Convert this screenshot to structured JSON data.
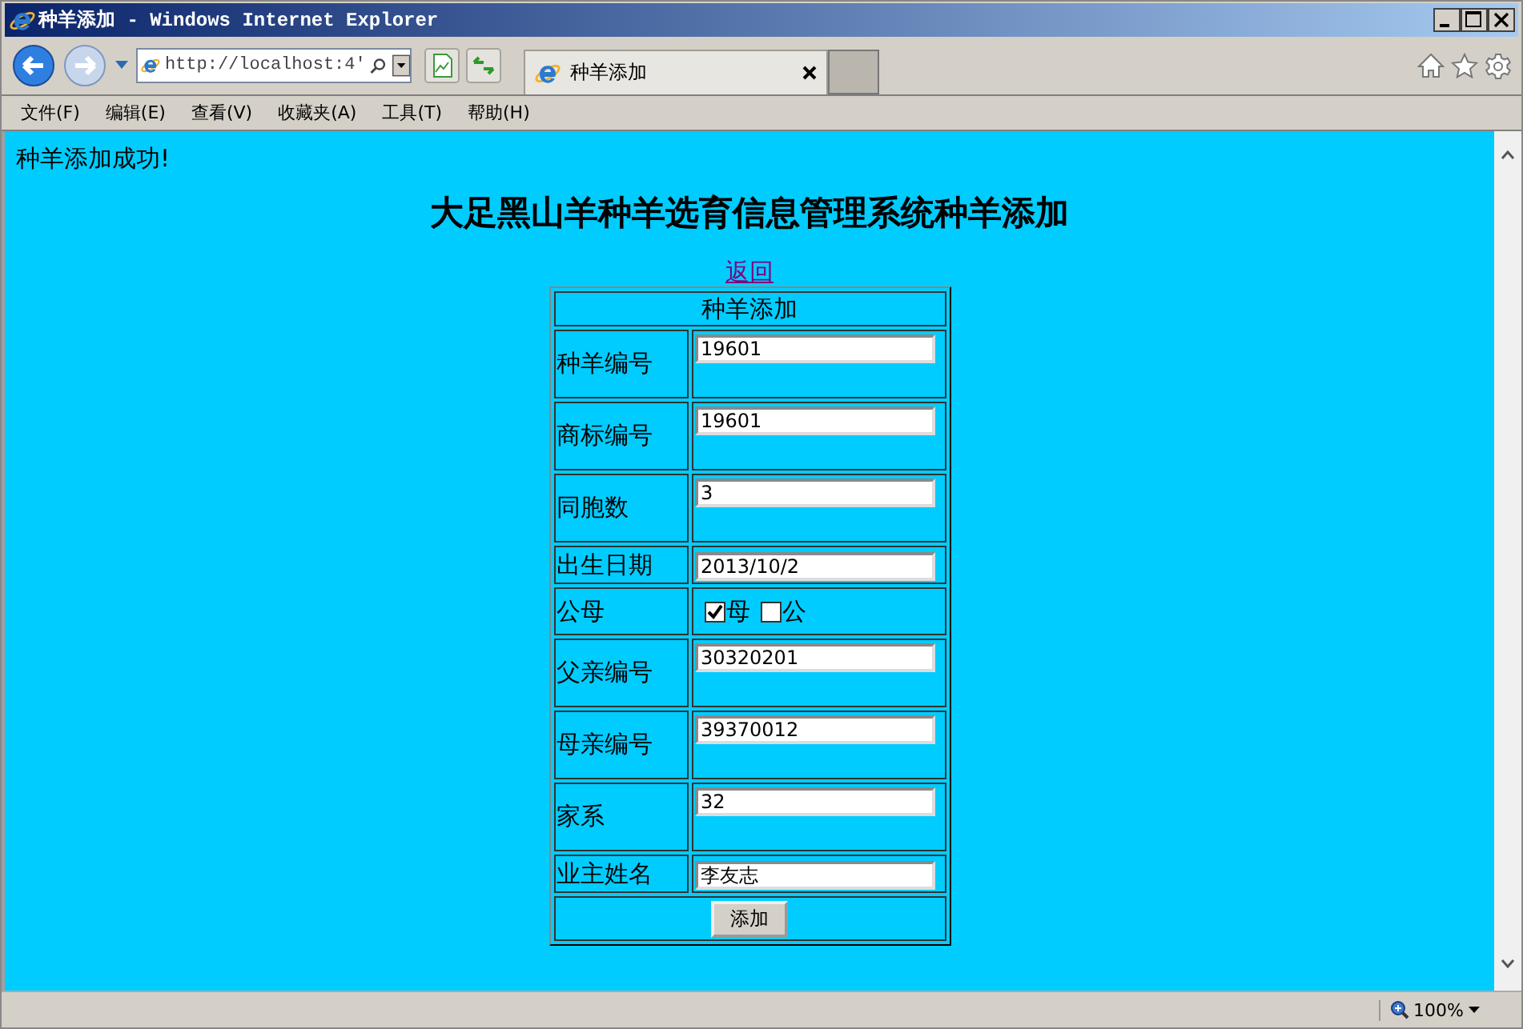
{
  "window": {
    "title": "种羊添加 - Windows Internet Explorer"
  },
  "address": {
    "url": "http://localhost:4'"
  },
  "tabs": [
    {
      "label": "种羊添加",
      "selected": true
    }
  ],
  "menu": [
    "文件(F)",
    "编辑(E)",
    "查看(V)",
    "收藏夹(A)",
    "工具(T)",
    "帮助(H)"
  ],
  "page": {
    "message": "种羊添加成功!",
    "heading": "大足黑山羊种羊选育信息管理系统种羊添加",
    "back_link": "返回",
    "form": {
      "title": "种羊添加",
      "fields": [
        {
          "kind": "spaced",
          "label": "种羊编号",
          "value": "19601"
        },
        {
          "kind": "spaced",
          "label": "商标编号",
          "value": "19601"
        },
        {
          "kind": "spaced",
          "label": "同胞数",
          "value": "3"
        },
        {
          "kind": "text",
          "label": "出生日期",
          "value": "2013/10/2"
        },
        {
          "kind": "choice",
          "label": "公母",
          "options": [
            {
              "label": "母",
              "checked": true
            },
            {
              "label": "公",
              "checked": false
            }
          ]
        },
        {
          "kind": "spaced",
          "label": "父亲编号",
          "value": "30320201"
        },
        {
          "kind": "spaced",
          "label": "母亲编号",
          "value": "39370012"
        },
        {
          "kind": "spaced",
          "label": "家系",
          "value": "32"
        },
        {
          "kind": "text",
          "label": "业主姓名",
          "value": "李友志"
        }
      ],
      "submit": "添加"
    }
  },
  "status_bar": {
    "zoom": "100%"
  }
}
